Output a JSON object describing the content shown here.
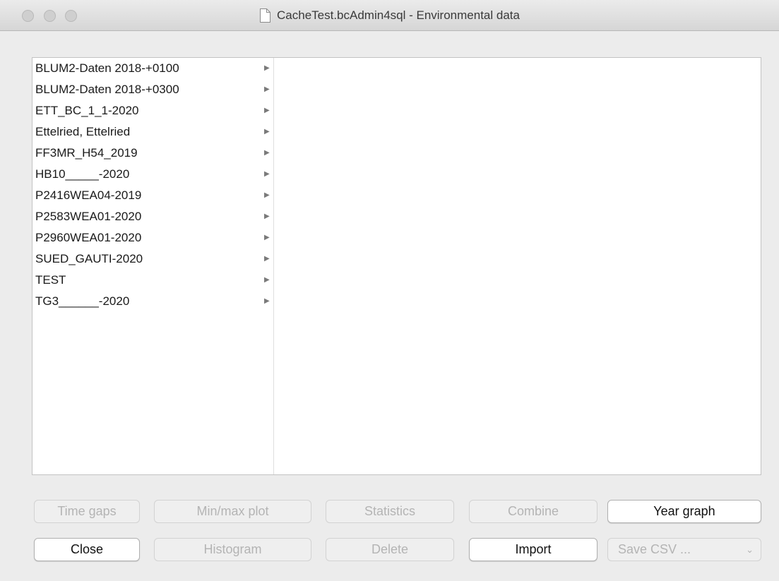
{
  "window": {
    "title": "CacheTest.bcAdmin4sql - Environmental data"
  },
  "datasets": [
    {
      "label": "BLUM2-Daten 2018-+0100"
    },
    {
      "label": "BLUM2-Daten 2018-+0300"
    },
    {
      "label": "ETT_BC_1_1-2020"
    },
    {
      "label": "Ettelried, Ettelried"
    },
    {
      "label": "FF3MR_H54_2019"
    },
    {
      "label": "HB10_____-2020"
    },
    {
      "label": "P2416WEA04-2019"
    },
    {
      "label": "P2583WEA01-2020"
    },
    {
      "label": "P2960WEA01-2020"
    },
    {
      "label": "SUED_GAUTI-2020"
    },
    {
      "label": "TEST"
    },
    {
      "label": "TG3______-2020"
    }
  ],
  "submenu_arrow": "▶",
  "buttons": {
    "time_gaps": "Time gaps",
    "min_max_plot": "Min/max plot",
    "statistics": "Statistics",
    "combine": "Combine",
    "year_graph": "Year graph",
    "close": "Close",
    "histogram": "Histogram",
    "delete": "Delete",
    "import": "Import"
  },
  "save_csv": {
    "selected": "Save CSV ...",
    "chevron": "⌄"
  },
  "icons": {
    "title_doc": "document-icon",
    "submenu": "submenu-arrow-icon"
  }
}
